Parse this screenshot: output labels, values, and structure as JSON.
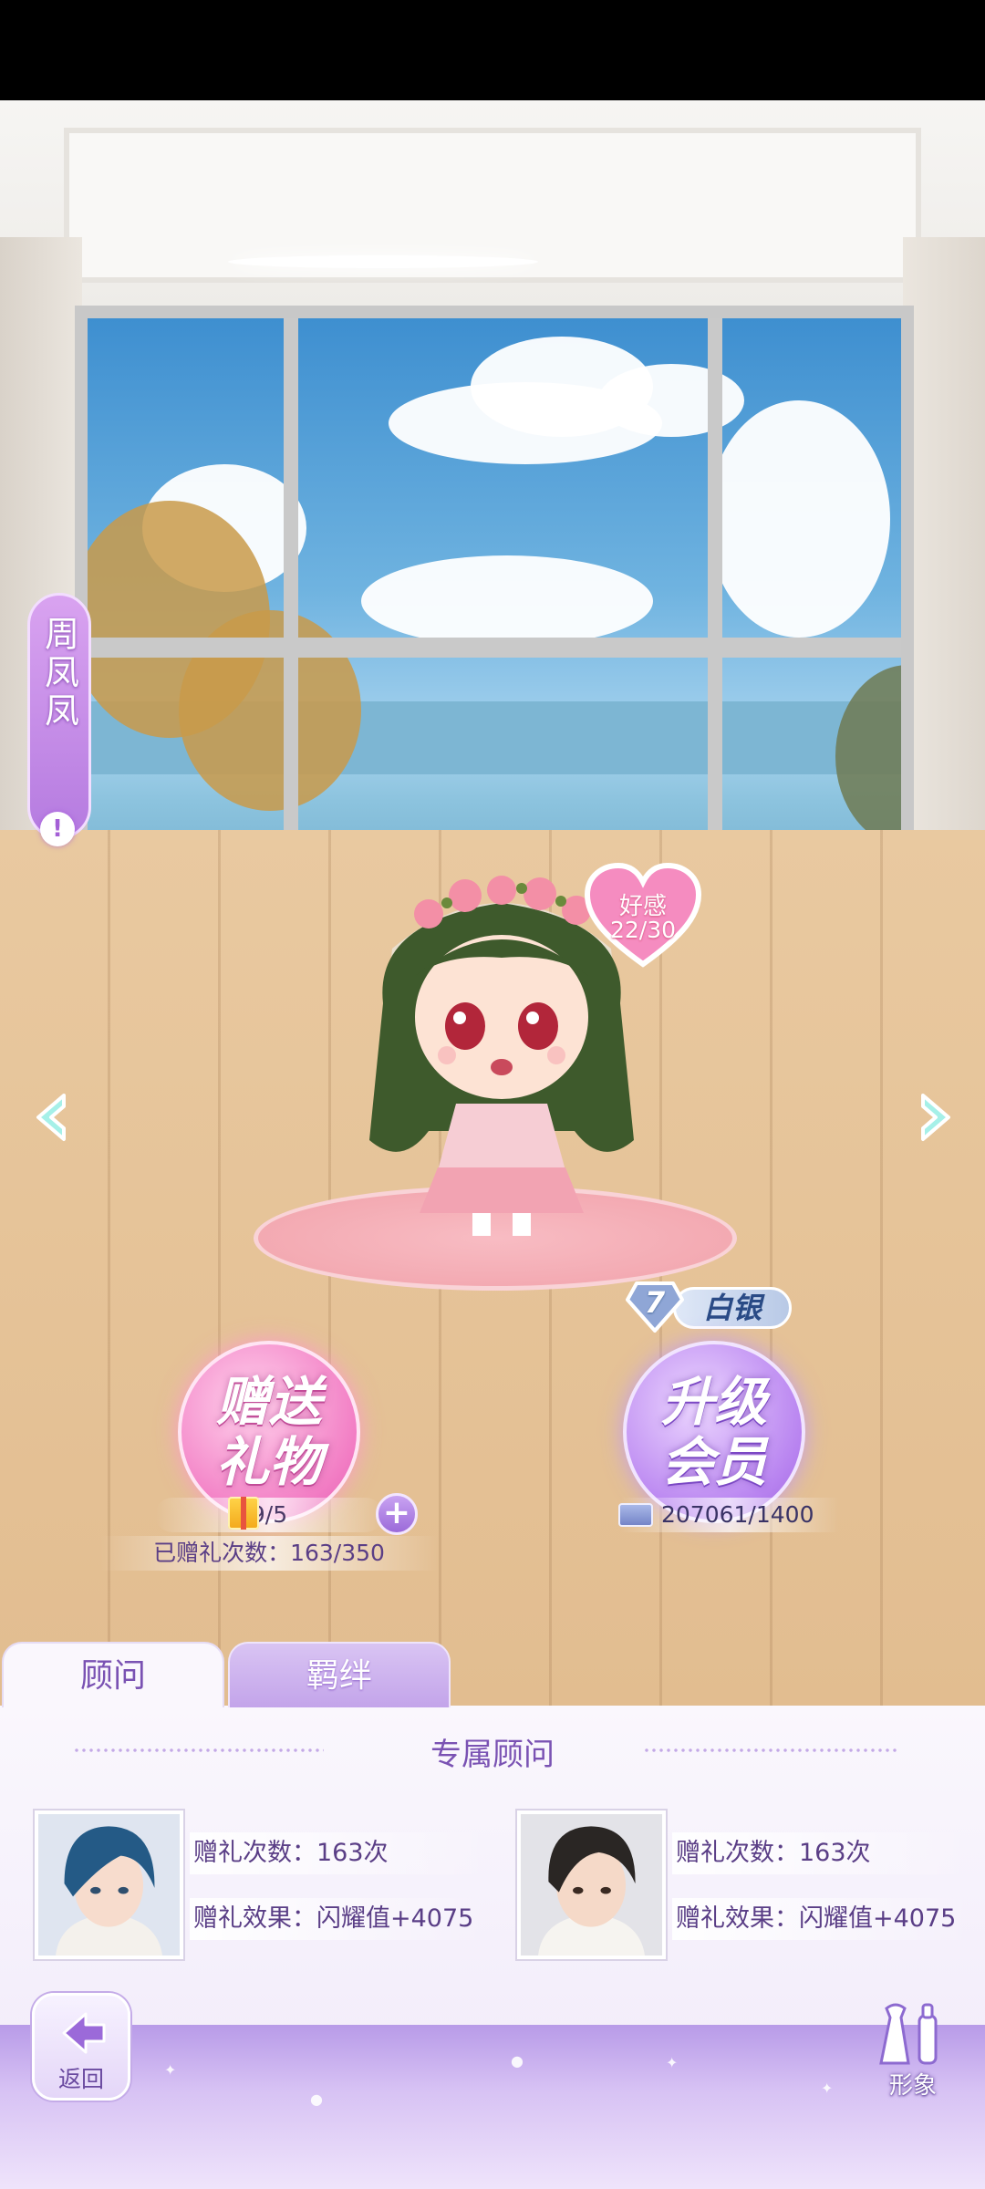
{
  "character": {
    "name": "周凤凤",
    "info_icon": "exclamation-icon",
    "affection_label": "好感",
    "affection_value": "22/30"
  },
  "gift_button": {
    "line1": "赠送",
    "line2": "礼物",
    "item_count": "9/5",
    "total_label": "已赠礼次数：163/350"
  },
  "vip": {
    "rank_level": "7",
    "rank_name": "白银",
    "line1": "升级",
    "line2": "会员",
    "progress": "207061/1400"
  },
  "tabs": [
    {
      "label": "顾问",
      "active": true
    },
    {
      "label": "羁绊",
      "active": false
    }
  ],
  "section_title": "专属顾问",
  "advisors": [
    {
      "gift_count": "赠礼次数：163次",
      "gift_effect": "赠礼效果：闪耀值+4075"
    },
    {
      "gift_count": "赠礼次数：163次",
      "gift_effect": "赠礼效果：闪耀值+4075"
    }
  ],
  "bottom_bar": {
    "back_label": "返回",
    "look_label": "形象"
  },
  "colors": {
    "accent_purple": "#7a52b3",
    "gift_pink": "#f27dc4",
    "vip_purple": "#b883f0"
  }
}
